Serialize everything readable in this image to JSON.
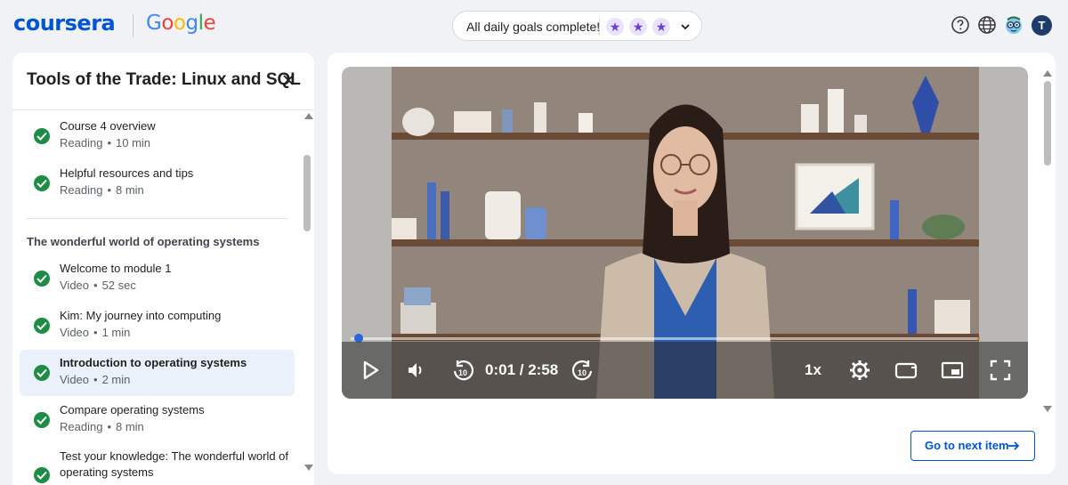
{
  "brand": {
    "coursera": "coursera",
    "partner": "Google"
  },
  "goals": {
    "text": "All daily goals complete!",
    "stars": 3
  },
  "user": {
    "initial": "T"
  },
  "course": {
    "title": "Tools of the Trade: Linux and SQL"
  },
  "sidebar": {
    "items_top": [
      {
        "title": "Course 4 overview",
        "type": "Reading",
        "duration": "10 min",
        "completed": true
      },
      {
        "title": "Helpful resources and tips",
        "type": "Reading",
        "duration": "8 min",
        "completed": true
      }
    ],
    "section_title": "The wonderful world of operating systems",
    "items": [
      {
        "title": "Welcome to module 1",
        "type": "Video",
        "duration": "52 sec",
        "completed": true
      },
      {
        "title": "Kim: My journey into computing",
        "type": "Video",
        "duration": "1 min",
        "completed": true
      },
      {
        "title": "Introduction to operating systems",
        "type": "Video",
        "duration": "2 min",
        "completed": true,
        "active": true
      },
      {
        "title": "Compare operating systems",
        "type": "Reading",
        "duration": "8 min",
        "completed": true
      },
      {
        "title": "Test your knowledge: The wonderful world of operating systems",
        "completed": true
      }
    ]
  },
  "player": {
    "time": "0:01 / 2:58",
    "speed": "1x",
    "progress": 0.006
  },
  "main": {
    "next_label": "Go to next item"
  },
  "colors": {
    "accent": "#0056d2",
    "complete": "#1e8c45",
    "star": "#6b3ce0"
  }
}
